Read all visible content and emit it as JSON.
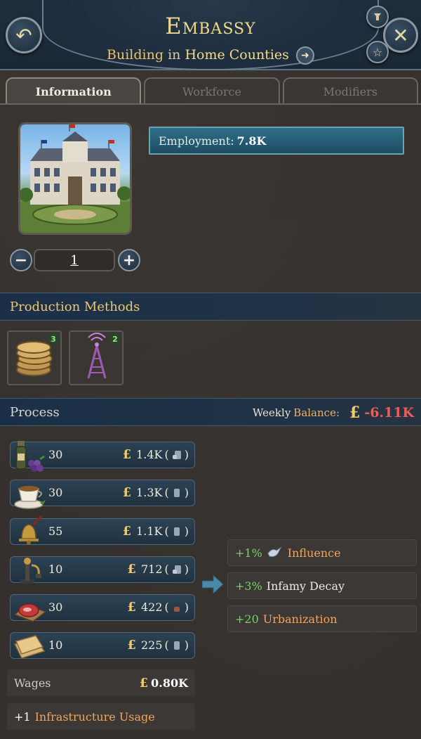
{
  "header": {
    "title": "Embassy",
    "subtitle_type": "Building",
    "subtitle_in": "in",
    "subtitle_location": "Home Counties",
    "back_icon": "back-arrow-icon",
    "close_icon": "close-icon",
    "pin_icon": "pin-icon",
    "star_icon": "star-icon"
  },
  "tabs": [
    {
      "label": "Information",
      "active": true
    },
    {
      "label": "Workforce",
      "active": false
    },
    {
      "label": "Modifiers",
      "active": false
    }
  ],
  "info": {
    "employment_label": "Employment:",
    "employment_value": "7.8K",
    "level": "1"
  },
  "production_methods": {
    "title": "Production Methods",
    "slots": [
      {
        "icon": "coins-icon",
        "count": "3"
      },
      {
        "icon": "radio-tower-icon",
        "count": "2"
      }
    ]
  },
  "process": {
    "title": "Process",
    "balance_label": "Weekly",
    "balance_label2": "Balance:",
    "balance_currency": "£",
    "balance_value": "-6.11K",
    "inputs": [
      {
        "icon": "wine-icon",
        "qty": "30",
        "cost": "1.4K"
      },
      {
        "icon": "tea-icon",
        "qty": "30",
        "cost": "1.3K"
      },
      {
        "icon": "bell-icon",
        "qty": "55",
        "cost": "1.1K"
      },
      {
        "icon": "telephone-icon",
        "qty": "10",
        "cost": "712"
      },
      {
        "icon": "meat-icon",
        "qty": "30",
        "cost": "422"
      },
      {
        "icon": "paper-icon",
        "qty": "10",
        "cost": "225"
      }
    ],
    "currency": "£",
    "wages_label": "Wages",
    "wages_value": "0.80K",
    "infra_value": "+1",
    "infra_label": "Infrastructure Usage",
    "outputs": [
      {
        "value": "+1%",
        "icon": "dove-icon",
        "label": "Influence"
      },
      {
        "value": "+3%",
        "label": "Infamy Decay"
      },
      {
        "value": "+20",
        "label": "Urbanization"
      }
    ]
  },
  "colors": {
    "accent_gold": "#f0cb6e",
    "negative": "#ef5b55",
    "positive": "#73d46a",
    "header_blue": "#1f2e3d"
  }
}
